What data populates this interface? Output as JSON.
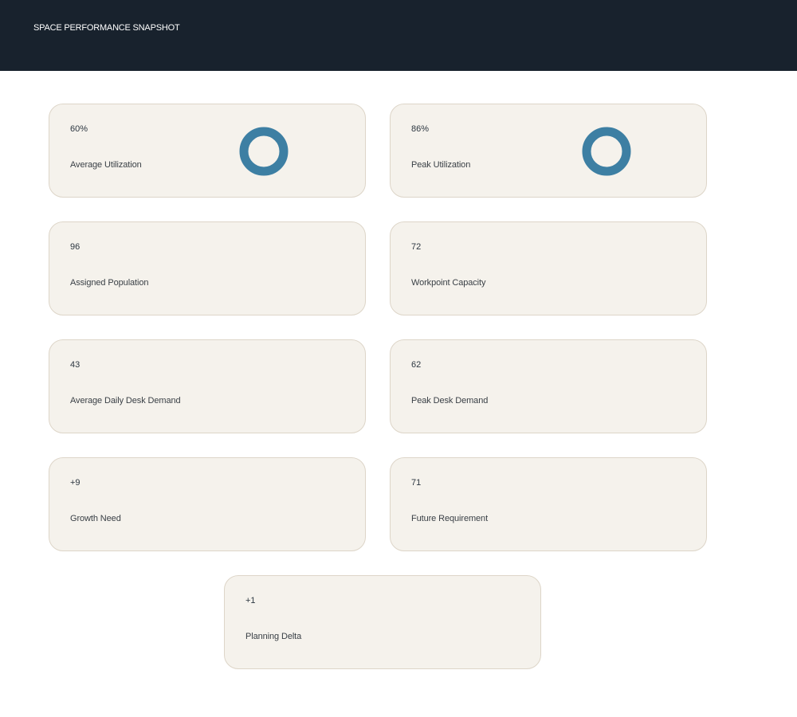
{
  "header": {
    "title": "SPACE PERFORMANCE SNAPSHOT"
  },
  "colors": {
    "header_bg": "#18222d",
    "card_bg": "#f5f2ec",
    "card_border": "#ddd5c8",
    "donut_accent": "#3d7fa3"
  },
  "cards": [
    {
      "value": "60%",
      "label": "Average Utilization",
      "icon": "donut-icon"
    },
    {
      "value": "86%",
      "label": "Peak Utilization",
      "icon": "donut-icon"
    },
    {
      "value": "96",
      "label": "Assigned Population"
    },
    {
      "value": "72",
      "label": "Workpoint Capacity"
    },
    {
      "value": "43",
      "label": "Average Daily Desk Demand"
    },
    {
      "value": "62",
      "label": "Peak Desk Demand"
    },
    {
      "value": "+9",
      "label": "Growth Need"
    },
    {
      "value": "71",
      "label": "Future Requirement"
    },
    {
      "value": "+1",
      "label": "Planning Delta"
    }
  ]
}
